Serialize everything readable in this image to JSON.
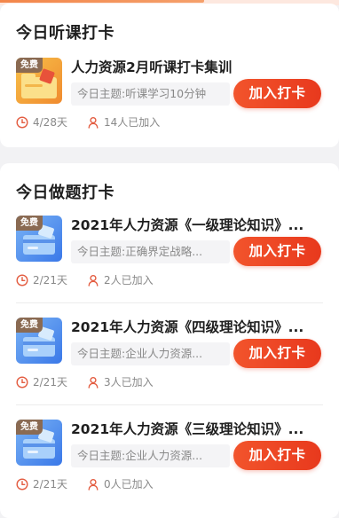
{
  "colors": {
    "accent": "#e8391d",
    "meta_icon": "#e35b3f",
    "background": "#f2f2f4"
  },
  "listen_section": {
    "title": "今日听课打卡",
    "items": [
      {
        "title": "人力资源2月听课打卡集训",
        "topic": "今日主题:听课学习10分钟",
        "button": "加入打卡",
        "days": "4/28天",
        "joined": "14人已加入",
        "badge": "免费",
        "thumb": "orange"
      }
    ]
  },
  "exercise_section": {
    "title": "今日做题打卡",
    "items": [
      {
        "title": "2021年人力资源《一级理论知识》...",
        "topic": "今日主题:正确界定战略...",
        "button": "加入打卡",
        "days": "2/21天",
        "joined": "2人已加入",
        "badge": "免费",
        "thumb": "blue"
      },
      {
        "title": "2021年人力资源《四级理论知识》...",
        "topic": "今日主题:企业人力资源...",
        "button": "加入打卡",
        "days": "2/21天",
        "joined": "3人已加入",
        "badge": "免费",
        "thumb": "blue"
      },
      {
        "title": "2021年人力资源《三级理论知识》...",
        "topic": "今日主题:企业人力资源...",
        "button": "加入打卡",
        "days": "2/21天",
        "joined": "0人已加入",
        "badge": "免费",
        "thumb": "blue"
      }
    ]
  }
}
